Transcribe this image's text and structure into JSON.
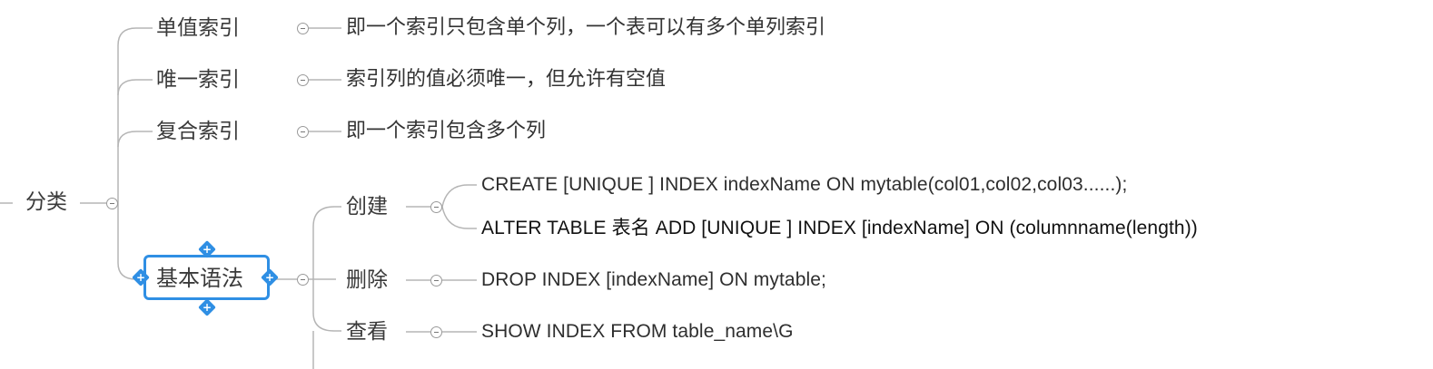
{
  "root": {
    "label": "分类"
  },
  "categories": [
    {
      "label": "单值索引",
      "description": "即一个索引只包含单个列，一个表可以有多个单列索引"
    },
    {
      "label": "唯一索引",
      "description": "索引列的值必须唯一，但允许有空值"
    },
    {
      "label": "复合索引",
      "description": "即一个索引包含多个列"
    }
  ],
  "syntax": {
    "label": "基本语法",
    "children": [
      {
        "label": "创建",
        "items": [
          "CREATE  [UNIQUE ] INDEX indexName ON mytable(col01,col02,col03......);",
          "ALTER TABLE 表名 ADD  [UNIQUE ]  INDEX [indexName] ON (columnname(length))"
        ]
      },
      {
        "label": "删除",
        "items": [
          "DROP INDEX [indexName] ON mytable;"
        ]
      },
      {
        "label": "查看",
        "items": [
          "SHOW INDEX FROM table_name\\G"
        ]
      }
    ]
  },
  "colors": {
    "selection": "#2f8fe4",
    "line": "#b3b3b3",
    "text": "#333333"
  }
}
